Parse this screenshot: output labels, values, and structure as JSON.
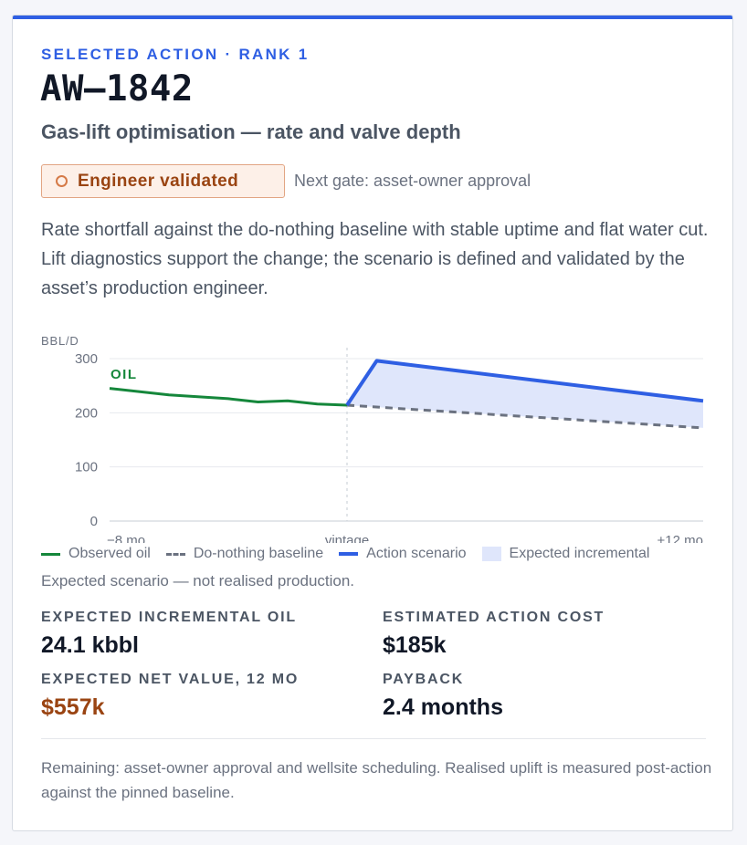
{
  "card": {
    "eyebrow": "SELECTED ACTION · RANK 1",
    "title": "AW–1842",
    "subtitle": "Gas-lift optimisation — rate and valve depth",
    "status_badge": "Engineer validated",
    "next_gate": "Next gate: asset-owner approval",
    "description": "Rate shortfall against the do-nothing baseline with stable uptime and flat water cut. Lift diagnostics support the change; the scenario is defined and validated by the asset’s production engineer.",
    "caption": "Expected scenario — not realised production.",
    "footnote": "Remaining: asset-owner approval and wellsite scheduling. Realised uplift is measured post-action against the pinned baseline."
  },
  "colors": {
    "accent": "#2f5fe3",
    "observed": "#15873b",
    "baseline": "#6b7280",
    "incremental_fill": "#dfe6fb",
    "status": "#9a4412"
  },
  "legend": {
    "observed": "Observed oil",
    "baseline": "Do-nothing baseline",
    "action": "Action scenario",
    "incremental": "Expected incremental"
  },
  "metrics": [
    {
      "label": "EXPECTED INCREMENTAL OIL",
      "value": "24.1 kbbl"
    },
    {
      "label": "ESTIMATED ACTION COST",
      "value": "$185k"
    },
    {
      "label": "EXPECTED NET VALUE, 12 MO",
      "value": "$557k"
    },
    {
      "label": "PAYBACK",
      "value": "2.4 months"
    }
  ],
  "chart_data": {
    "type": "line",
    "ylabel": "BBL/D",
    "ylim": [
      0,
      300
    ],
    "yticks": [
      0,
      100,
      200,
      300
    ],
    "xlim": [
      -8,
      12
    ],
    "xtick_labels": [
      {
        "x": -8,
        "label": "−8 mo"
      },
      {
        "x": 0,
        "label": "vintage"
      },
      {
        "x": 12,
        "label": "+12 mo"
      }
    ],
    "annotation": "OIL",
    "grid": true,
    "series": [
      {
        "name": "Observed oil",
        "style": "solid",
        "x": [
          -8,
          -6,
          -4,
          -3,
          -2,
          -1,
          0
        ],
        "y": [
          245,
          233,
          226,
          220,
          222,
          216,
          214
        ]
      },
      {
        "name": "Do-nothing baseline",
        "style": "dashed",
        "x": [
          0,
          12
        ],
        "y": [
          214,
          172
        ]
      },
      {
        "name": "Action scenario",
        "style": "solid",
        "x": [
          0,
          1,
          12
        ],
        "y": [
          214,
          296,
          222
        ]
      }
    ]
  }
}
